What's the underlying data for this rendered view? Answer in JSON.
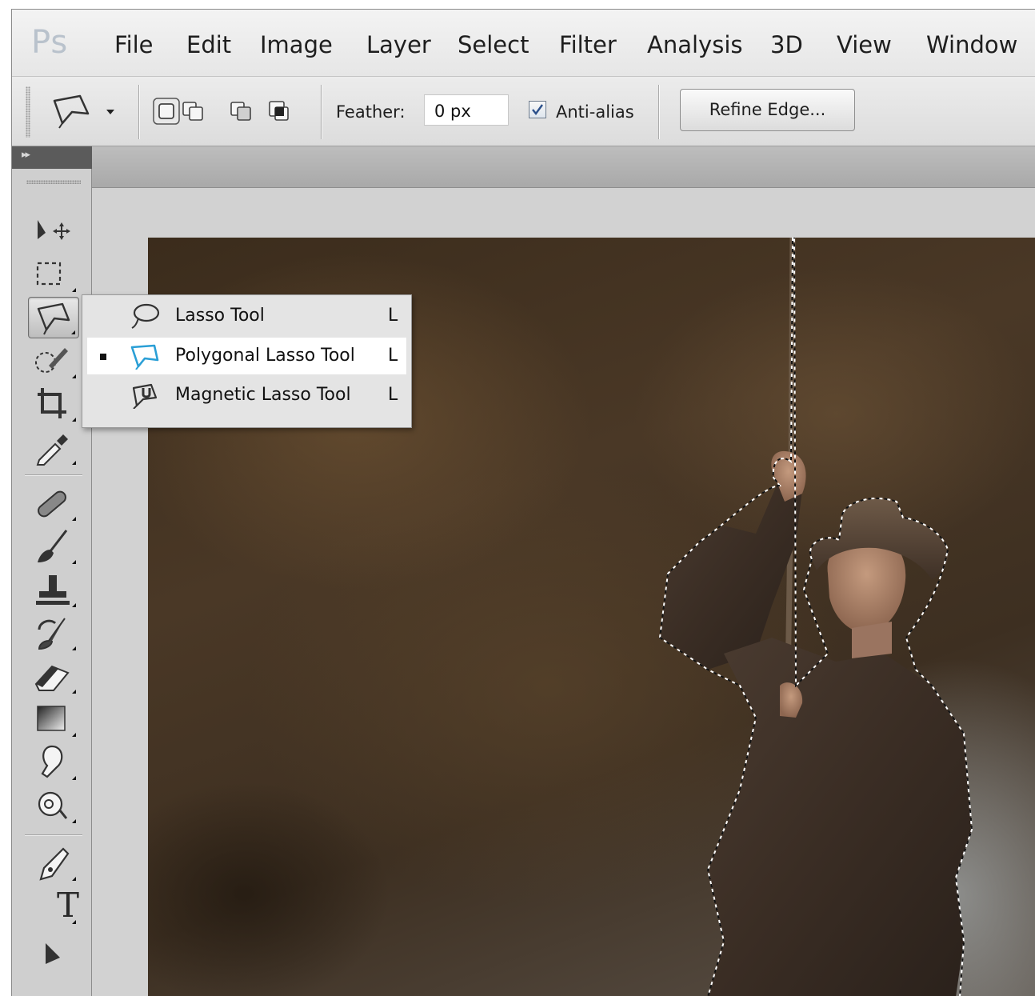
{
  "app": {
    "logo": "Ps"
  },
  "menubar": {
    "items": [
      "File",
      "Edit",
      "Image",
      "Layer",
      "Select",
      "Filter",
      "Analysis",
      "3D",
      "View",
      "Window"
    ]
  },
  "options_bar": {
    "tool_preset_icon": "polygonal-lasso-icon",
    "selection_modes": [
      "new-selection-icon",
      "add-to-selection-icon",
      "subtract-from-selection-icon",
      "intersect-selection-icon"
    ],
    "feather_label": "Feather:",
    "feather_value": "0 px",
    "antialias_label": "Anti-alias",
    "antialias_checked": true,
    "refine_edge_label": "Refine Edge..."
  },
  "tools_panel": {
    "collapse_glyph": "▸▸",
    "type_tool_glyph": "T",
    "tools": [
      "move-tool-icon",
      "marquee-tool-icon",
      "polygonal-lasso-tool-icon",
      "quick-selection-tool-icon",
      "crop-tool-icon",
      "eyedropper-tool-icon",
      "spot-healing-tool-icon",
      "brush-tool-icon",
      "clone-stamp-tool-icon",
      "history-brush-tool-icon",
      "eraser-tool-icon",
      "gradient-tool-icon",
      "blur-tool-icon",
      "dodge-tool-icon",
      "pen-tool-icon",
      "type-tool-icon",
      "path-selection-tool-icon"
    ],
    "active_tool": "polygonal-lasso-tool-icon"
  },
  "lasso_flyout": {
    "items": [
      {
        "label": "Lasso Tool",
        "shortcut": "L",
        "icon": "lasso-icon",
        "selected": false
      },
      {
        "label": "Polygonal Lasso Tool",
        "shortcut": "L",
        "icon": "polygonal-lasso-icon",
        "selected": true
      },
      {
        "label": "Magnetic Lasso Tool",
        "shortcut": "L",
        "icon": "magnetic-lasso-icon",
        "selected": false
      }
    ]
  },
  "colors": {
    "accent": "#2a9fd6",
    "canvas_dark": "#3b2c1c",
    "panel": "#cfcfcf"
  }
}
